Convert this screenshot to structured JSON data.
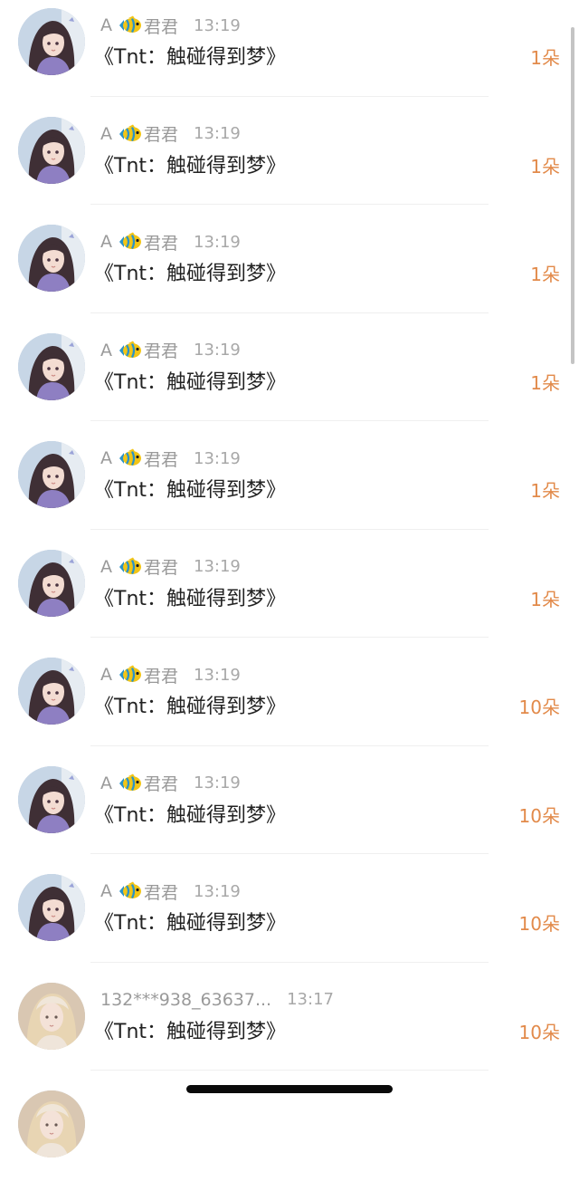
{
  "gift_list": {
    "items": [
      {
        "name_prefix": "A",
        "fish": true,
        "name_suffix": "君君",
        "time": "13:19",
        "title": "《Tnt：触碰得到梦》",
        "count": "1朵",
        "avatar": "anime-girl"
      },
      {
        "name_prefix": "A",
        "fish": true,
        "name_suffix": "君君",
        "time": "13:19",
        "title": "《Tnt：触碰得到梦》",
        "count": "1朵",
        "avatar": "anime-girl"
      },
      {
        "name_prefix": "A",
        "fish": true,
        "name_suffix": "君君",
        "time": "13:19",
        "title": "《Tnt：触碰得到梦》",
        "count": "1朵",
        "avatar": "anime-girl"
      },
      {
        "name_prefix": "A",
        "fish": true,
        "name_suffix": "君君",
        "time": "13:19",
        "title": "《Tnt：触碰得到梦》",
        "count": "1朵",
        "avatar": "anime-girl"
      },
      {
        "name_prefix": "A",
        "fish": true,
        "name_suffix": "君君",
        "time": "13:19",
        "title": "《Tnt：触碰得到梦》",
        "count": "1朵",
        "avatar": "anime-girl"
      },
      {
        "name_prefix": "A",
        "fish": true,
        "name_suffix": "君君",
        "time": "13:19",
        "title": "《Tnt：触碰得到梦》",
        "count": "1朵",
        "avatar": "anime-girl"
      },
      {
        "name_prefix": "A",
        "fish": true,
        "name_suffix": "君君",
        "time": "13:19",
        "title": "《Tnt：触碰得到梦》",
        "count": "10朵",
        "avatar": "anime-girl"
      },
      {
        "name_prefix": "A",
        "fish": true,
        "name_suffix": "君君",
        "time": "13:19",
        "title": "《Tnt：触碰得到梦》",
        "count": "10朵",
        "avatar": "anime-girl"
      },
      {
        "name_prefix": "A",
        "fish": true,
        "name_suffix": "君君",
        "time": "13:19",
        "title": "《Tnt：触碰得到梦》",
        "count": "10朵",
        "avatar": "anime-girl"
      },
      {
        "name_prefix": "132***938_63637...",
        "fish": false,
        "name_suffix": "",
        "time": "13:17",
        "title": "《Tnt：触碰得到梦》",
        "count": "10朵",
        "avatar": "blonde-girl"
      }
    ]
  },
  "colors": {
    "count_accent": "#e28a4a",
    "name_gray": "#9a9a9a",
    "title_text": "#222222",
    "divider": "#efefef"
  }
}
